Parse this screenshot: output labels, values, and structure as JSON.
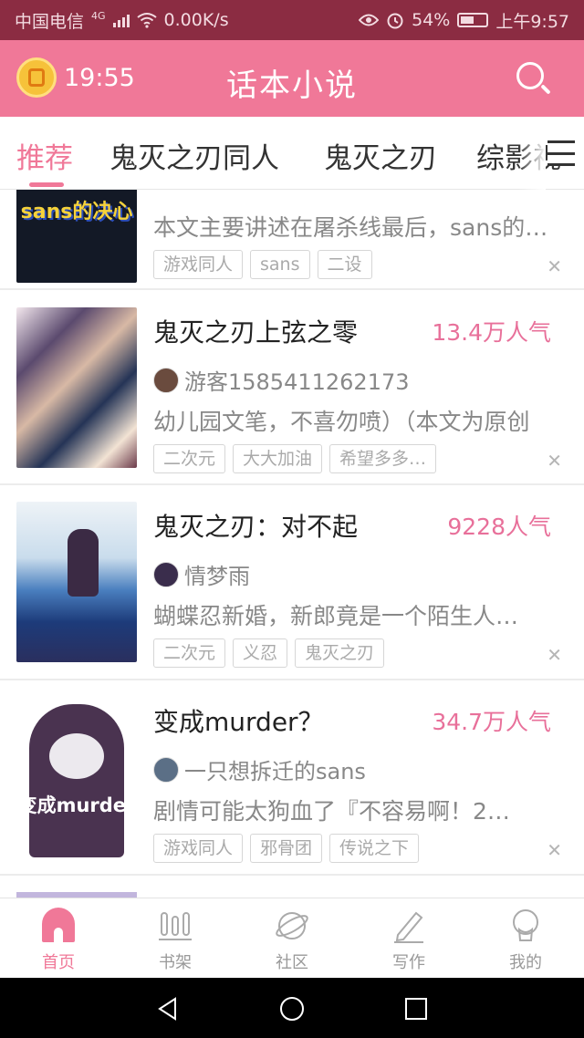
{
  "status_bar": {
    "carrier": "中国电信",
    "network": "4G",
    "speed": "0.00K/s",
    "battery": "54%",
    "time": "上午9:57"
  },
  "header": {
    "alarm_time": "19:55",
    "title": "话本小说",
    "icons": {
      "alarm": "alarm-clock-icon",
      "search": "search-icon"
    }
  },
  "tabs": {
    "items": [
      "推荐",
      "鬼灭之刃同人",
      "鬼灭之刃",
      "综影视"
    ],
    "active": 0,
    "menu_icon": "menu-icon"
  },
  "feed": {
    "partial_top": {
      "desc": "本文主要讲述在屠杀线最后，sans的决心",
      "tags": [
        "游戏同人",
        "sans",
        "二设"
      ],
      "cover_text": "sans的决心"
    },
    "items": [
      {
        "title": "鬼灭之刃上弦之零",
        "popularity": "13.4万人气",
        "author": "游客1585411262173",
        "desc": "幼儿园文笔，不喜勿喷）（本文为原创",
        "tags": [
          "二次元",
          "大大加油",
          "希望多多…"
        ]
      },
      {
        "title": "鬼灭之刃：对不起",
        "popularity": "9228人气",
        "author": "情梦雨",
        "desc": "蝴蝶忍新婚，新郎竟是一个陌生人…",
        "tags": [
          "二次元",
          "义忍",
          "鬼灭之刃"
        ]
      },
      {
        "title": "变成murder？",
        "popularity": "34.7万人气",
        "author": "一只想拆迁的sans",
        "desc": "剧情可能太狗血了『不容易啊！2…",
        "tags": [
          "游戏同人",
          "邪骨团",
          "传说之下"
        ],
        "cover_text": "变成murder"
      }
    ],
    "dismiss_label": "✕"
  },
  "bottom_nav": {
    "items": [
      {
        "label": "首页",
        "icon": "home-icon"
      },
      {
        "label": "书架",
        "icon": "bookshelf-icon"
      },
      {
        "label": "社区",
        "icon": "planet-icon"
      },
      {
        "label": "写作",
        "icon": "pencil-icon"
      },
      {
        "label": "我的",
        "icon": "profile-icon"
      }
    ],
    "active": 0
  },
  "colors": {
    "brand": "#f07898",
    "status_bar": "#8b2c42",
    "popularity": "#e8709a"
  }
}
